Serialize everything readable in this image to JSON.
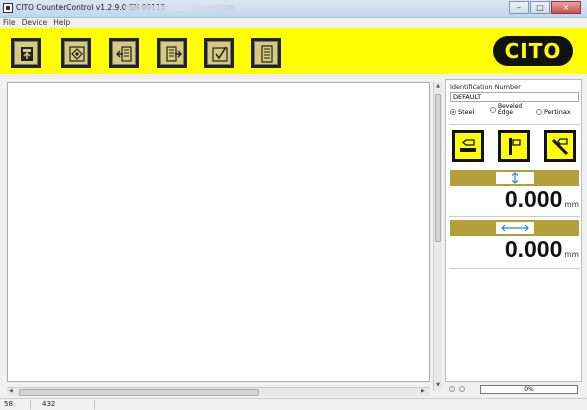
{
  "window": {
    "title": "CITO CounterControl v1.2.9.0 SN 00115"
  },
  "menu": [
    "File",
    "Device",
    "Help"
  ],
  "toolbar": {
    "buttons": [
      "connect-device",
      "target",
      "import",
      "export",
      "check",
      "report"
    ]
  },
  "brand": {
    "logo_text": "CITO"
  },
  "panel": {
    "id_label": "Identification Number",
    "id_value": "DEFAULT",
    "materials": [
      {
        "label": "Steel",
        "selected": true
      },
      {
        "label": "Beveled\nEdge",
        "selected": false
      },
      {
        "label": "Pertinax",
        "selected": false
      }
    ],
    "height_value": "0.000",
    "height_unit": "mm",
    "width_value": "0.000",
    "width_unit": "mm",
    "progress": "0%",
    "progress_fraction": 0
  },
  "statusbar": {
    "left": "58",
    "right": "432"
  },
  "colors": {
    "toolbar_bg": "#ffff00",
    "gauge_bar": "#b4a03a",
    "accent_blue": "#1d88d8"
  }
}
